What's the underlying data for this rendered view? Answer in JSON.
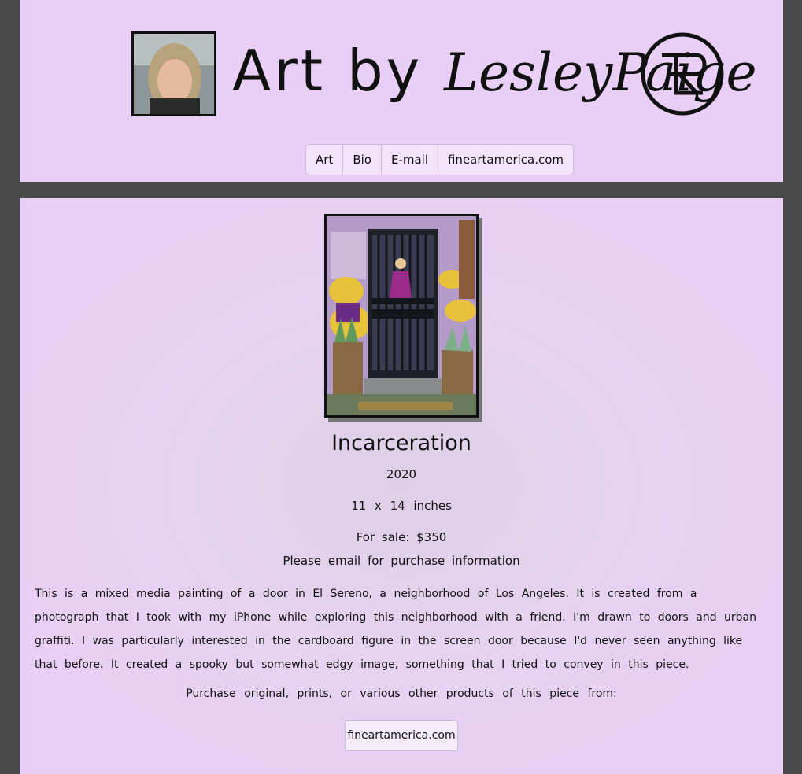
{
  "header": {
    "logo_prefix": "Art by ",
    "logo_signature": "LesleyPaige"
  },
  "nav": {
    "items": [
      {
        "label": "Art"
      },
      {
        "label": "Bio"
      },
      {
        "label": "E-mail"
      },
      {
        "label": "fineartamerica.com"
      }
    ]
  },
  "artwork": {
    "title": "Incarceration",
    "year": "2020",
    "size": "11 x 14 inches",
    "sale": "For sale: $350",
    "email_note": "Please email for purchase information",
    "description": "This is a mixed media painting of a door in El Sereno, a neighborhood of Los Angeles. It is created from a photograph that I took with my iPhone while exploring this neighborhood with a friend. I'm drawn to doors and urban graffiti. I was particularly interested in the cardboard figure in the screen door because I'd never seen anything like that before. It created a spooky but somewhat edgy image, something that I tried to convey in this piece.",
    "purchase_prompt": "Purchase original, prints, or various other products of this piece from:",
    "purchase_link": "fineartamerica.com"
  },
  "colors": {
    "panel": "#e9cff5",
    "background": "#4a4a4a",
    "figure_dress": "#9b2a8a",
    "door": "#2a2a38"
  }
}
